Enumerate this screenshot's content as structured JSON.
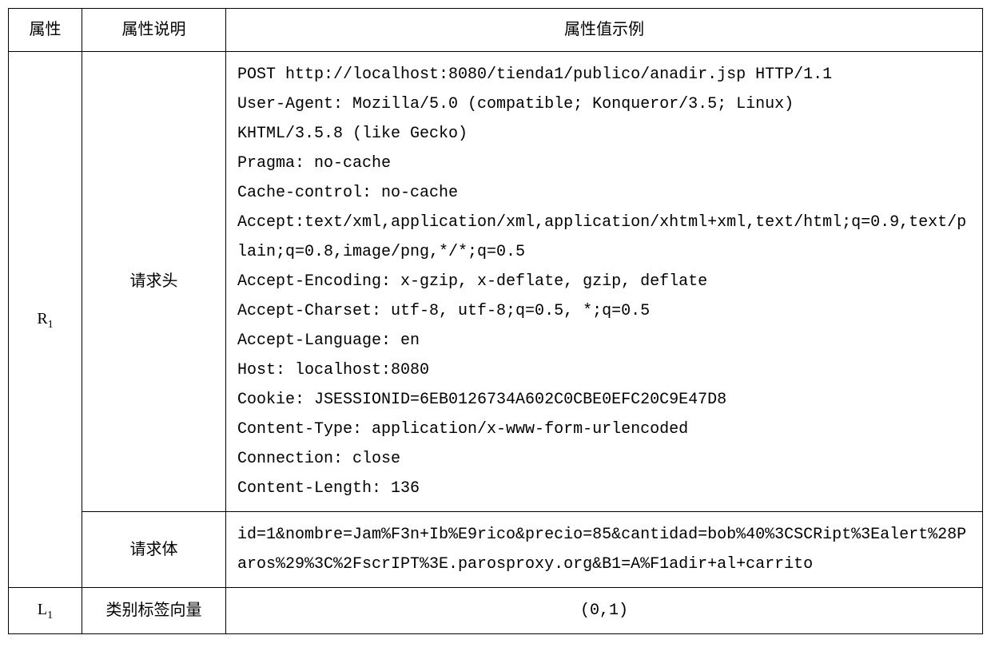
{
  "header": {
    "attr": "属性",
    "desc": "属性说明",
    "example": "属性值示例"
  },
  "rows": {
    "r1": {
      "attr_html": "R<sub>1</sub>",
      "desc_header": "请求头",
      "example_header": "POST http://localhost:8080/tienda1/publico/anadir.jsp HTTP/1.1\nUser-Agent: Mozilla/5.0 (compatible; Konqueror/3.5; Linux)\nKHTML/3.5.8 (like Gecko)\nPragma: no-cache\nCache-control: no-cache\nAccept:text/xml,application/xml,application/xhtml+xml,text/html;q=0.9,text/plain;q=0.8,image/png,*/*;q=0.5\nAccept-Encoding: x-gzip, x-deflate, gzip, deflate\nAccept-Charset: utf-8, utf-8;q=0.5, *;q=0.5\nAccept-Language: en\nHost: localhost:8080\nCookie: JSESSIONID=6EB0126734A602C0CBE0EFC20C9E47D8\nContent-Type: application/x-www-form-urlencoded\nConnection: close\nContent-Length: 136",
      "desc_body": "请求体",
      "example_body": "id=1&nombre=Jam%F3n+Ib%E9rico&precio=85&cantidad=bob%40%3CSCRipt%3Ealert%28Paros%29%3C%2FscrIPT%3E.parosproxy.org&B1=A%F1adir+al+carrito"
    },
    "l1": {
      "attr_html": "L<sub>1</sub>",
      "desc": "类别标签向量",
      "example": "(0,1)"
    }
  }
}
